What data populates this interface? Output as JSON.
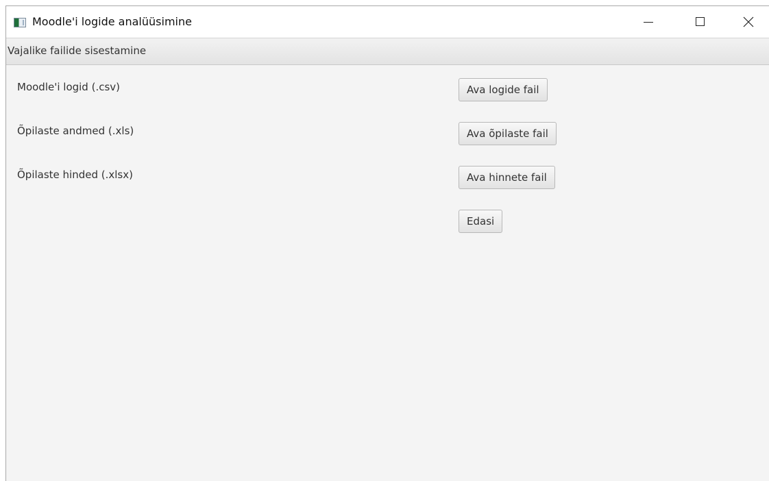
{
  "window": {
    "title": "Moodle'i logide analüüsimine",
    "icon": "app-window-icon"
  },
  "window_controls": {
    "minimize_icon": "minimize-icon",
    "maximize_icon": "maximize-icon",
    "close_icon": "close-icon"
  },
  "menubar": {
    "items": [
      {
        "label": "Vajalike failide sisestamine"
      }
    ]
  },
  "form": {
    "rows": [
      {
        "label": "Moodle'i logid (.csv)",
        "button": "Ava logide fail"
      },
      {
        "label": "Õpilaste andmed (.xls)",
        "button": "Ava õpilaste fail"
      },
      {
        "label": "Õpilaste hinded (.xlsx)",
        "button": "Ava hinnete fail"
      }
    ],
    "next_button": "Edasi"
  },
  "colors": {
    "background": "#f4f4f4",
    "titlebar": "#ffffff",
    "text": "#333333"
  }
}
